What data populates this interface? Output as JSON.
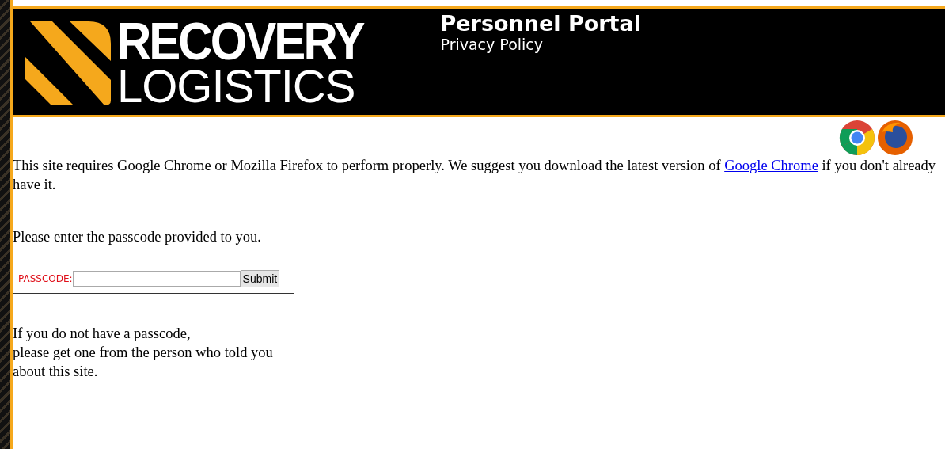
{
  "header": {
    "logo_top": "RECOVERY",
    "logo_bottom": "LOGISTICS",
    "title": "Personnel Portal",
    "privacy_link": "Privacy Policy"
  },
  "notice": {
    "before_link": "This site requires Google Chrome or Mozilla Firefox to perform properly. We suggest you download the latest version of",
    "link": "Google Chrome",
    "after_link": "if you don't already have it."
  },
  "instruction": "Please enter the passcode provided to you.",
  "form": {
    "label": "PASSCODE:",
    "button": "Submit"
  },
  "help_lines": [
    "If you do not have a passcode,",
    "please get one from the person who told you",
    "about this site."
  ]
}
